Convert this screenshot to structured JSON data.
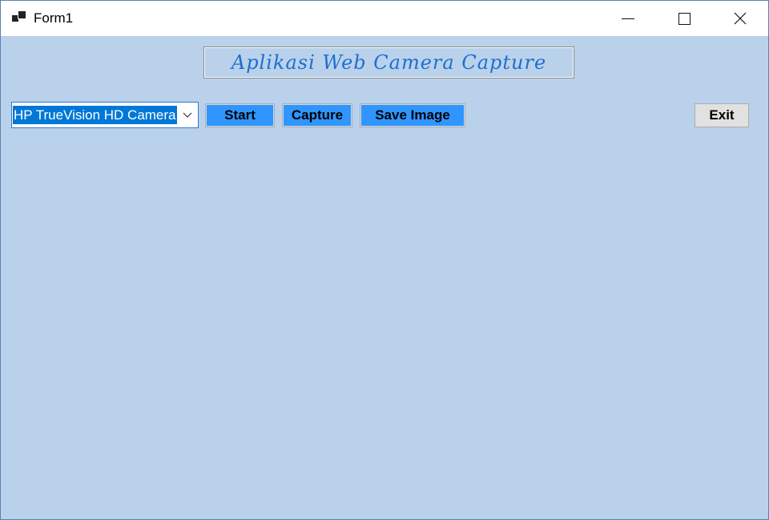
{
  "window": {
    "title": "Form1",
    "controls": {
      "minimize_icon": "minimize-icon",
      "maximize_icon": "maximize-icon",
      "close_icon": "close-icon"
    }
  },
  "banner": {
    "text": "Aplikasi Web Camera Capture",
    "color": "#1e6fd1"
  },
  "camera_select": {
    "selected": "HP TrueVision HD Camera",
    "icon": "chevron-down-icon"
  },
  "buttons": {
    "start": "Start",
    "capture": "Capture",
    "save_image": "Save Image",
    "exit": "Exit"
  },
  "colors": {
    "background": "#b9d1ea",
    "accent_button": "#2f95ff",
    "selection": "#0078d7"
  }
}
